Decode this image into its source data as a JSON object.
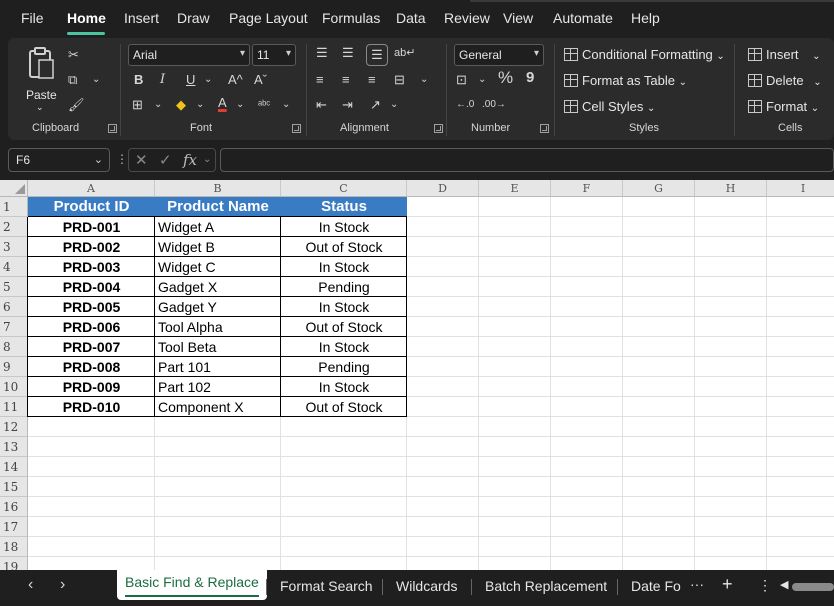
{
  "menu": {
    "tabs": [
      "File",
      "Home",
      "Insert",
      "Draw",
      "Page Layout",
      "Formulas",
      "Data",
      "Review",
      "View",
      "Automate",
      "Help"
    ],
    "active": "Home"
  },
  "ribbon": {
    "clipboard": {
      "label": "Clipboard",
      "paste": "Paste"
    },
    "font": {
      "label": "Font",
      "name": "Arial",
      "size": "11",
      "bold": "B",
      "italic": "I",
      "underline": "U",
      "grow": "A^",
      "shrink": "Aˇ"
    },
    "alignment": {
      "label": "Alignment"
    },
    "number": {
      "label": "Number",
      "format": "General",
      "percent": "%",
      "comma": "9"
    },
    "styles": {
      "label": "Styles",
      "conditional": "Conditional Formatting",
      "table": "Format as Table",
      "cell": "Cell Styles"
    },
    "cells": {
      "label": "Cells",
      "insert": "Insert",
      "delete": "Delete",
      "format": "Format"
    }
  },
  "formula_bar": {
    "name_box": "F6",
    "fx": "fx",
    "value": ""
  },
  "grid": {
    "columns": [
      "A",
      "B",
      "C",
      "D",
      "E",
      "F",
      "G",
      "H",
      "I"
    ],
    "rows": [
      "1",
      "2",
      "3",
      "4",
      "5",
      "6",
      "7",
      "8",
      "9",
      "10",
      "11",
      "12",
      "13",
      "14",
      "15",
      "16",
      "17",
      "18",
      "19"
    ],
    "table": {
      "headers": [
        "Product ID",
        "Product Name",
        "Status"
      ],
      "rows": [
        [
          "PRD-001",
          "Widget A",
          "In Stock"
        ],
        [
          "PRD-002",
          "Widget B",
          "Out of Stock"
        ],
        [
          "PRD-003",
          "Widget C",
          "In Stock"
        ],
        [
          "PRD-004",
          "Gadget X",
          "Pending"
        ],
        [
          "PRD-005",
          "Gadget Y",
          "In Stock"
        ],
        [
          "PRD-006",
          "Tool Alpha",
          "Out of Stock"
        ],
        [
          "PRD-007",
          "Tool Beta",
          "In Stock"
        ],
        [
          "PRD-008",
          "Part 101",
          "Pending"
        ],
        [
          "PRD-009",
          "Part 102",
          "In Stock"
        ],
        [
          "PRD-010",
          "Component X",
          "Out of Stock"
        ]
      ]
    }
  },
  "sheets": {
    "tabs": [
      "Basic Find & Replace",
      "Format Search",
      "Wildcards",
      "Batch Replacement",
      "Date Fo"
    ],
    "active": "Basic Find & Replace",
    "more": "···",
    "add": "+"
  },
  "colors": {
    "header_fill": "#3a7cc3",
    "accent": "#4cc2a0",
    "active_tab_text": "#1a6e3e"
  }
}
